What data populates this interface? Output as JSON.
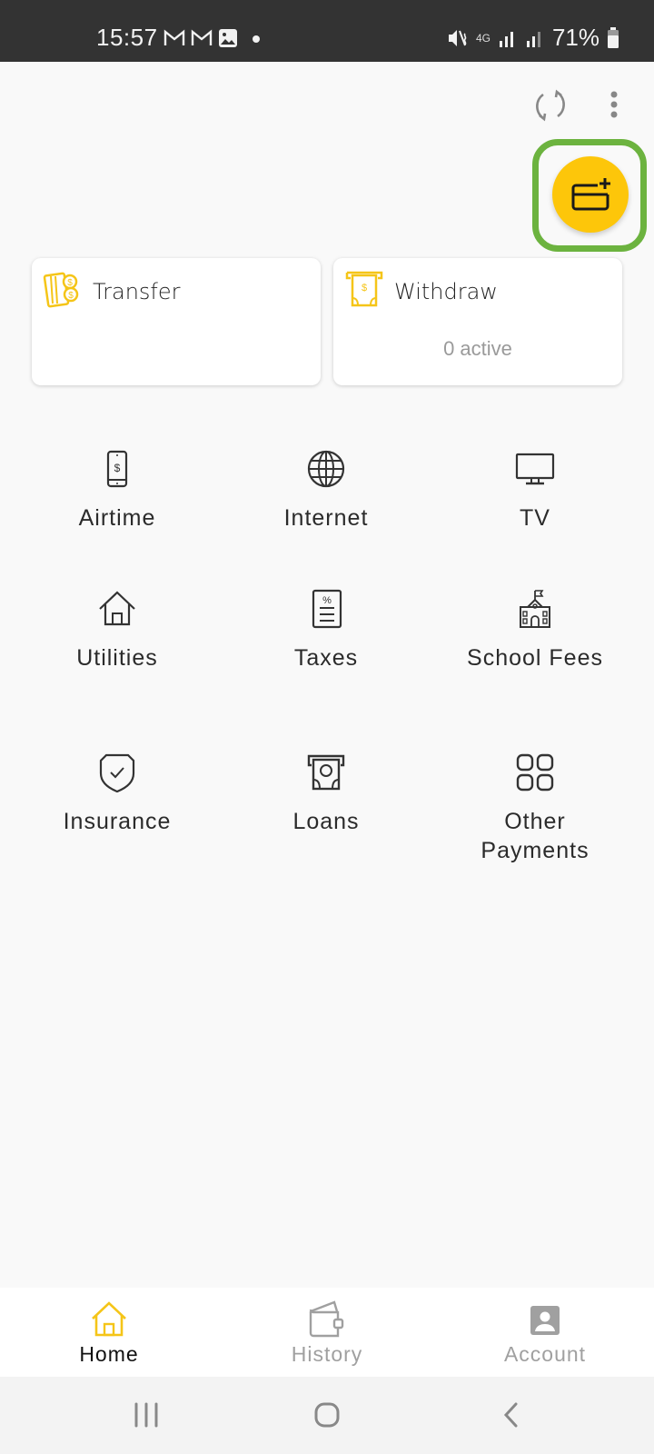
{
  "status_bar": {
    "time": "15:57",
    "notification_icons": [
      "gmail-icon",
      "gmail-icon",
      "image-icon",
      "dot-icon"
    ],
    "network": "4G",
    "battery": "71%"
  },
  "toolbar": {
    "refresh_icon": "refresh-icon",
    "menu_icon": "more-vertical-icon"
  },
  "fab": {
    "icon": "add-card-icon",
    "highlight_color": "#6cb33f",
    "color": "#fdc60a"
  },
  "cards": [
    {
      "title": "Transfer",
      "icon": "money-transfer-icon",
      "subtitle": ""
    },
    {
      "title": "Withdraw",
      "icon": "atm-withdraw-icon",
      "subtitle": "0 active"
    }
  ],
  "services": [
    {
      "label": "Airtime",
      "icon": "phone-dollar-icon"
    },
    {
      "label": "Internet",
      "icon": "globe-icon"
    },
    {
      "label": "TV",
      "icon": "monitor-icon"
    },
    {
      "label": "Utilities",
      "icon": "house-icon"
    },
    {
      "label": "Taxes",
      "icon": "tax-document-icon"
    },
    {
      "label": "School Fees",
      "icon": "school-icon"
    },
    {
      "label": "Insurance",
      "icon": "shield-check-icon"
    },
    {
      "label": "Loans",
      "icon": "cash-dispense-icon"
    },
    {
      "label": "Other Payments",
      "icon": "grid-icon"
    }
  ],
  "bottom_nav": [
    {
      "label": "Home",
      "icon": "home-icon",
      "active": true
    },
    {
      "label": "History",
      "icon": "wallet-icon",
      "active": false
    },
    {
      "label": "Account",
      "icon": "account-icon",
      "active": false
    }
  ],
  "colors": {
    "accent": "#f5c518",
    "active_text": "#111111",
    "inactive": "#a0a0a0"
  }
}
